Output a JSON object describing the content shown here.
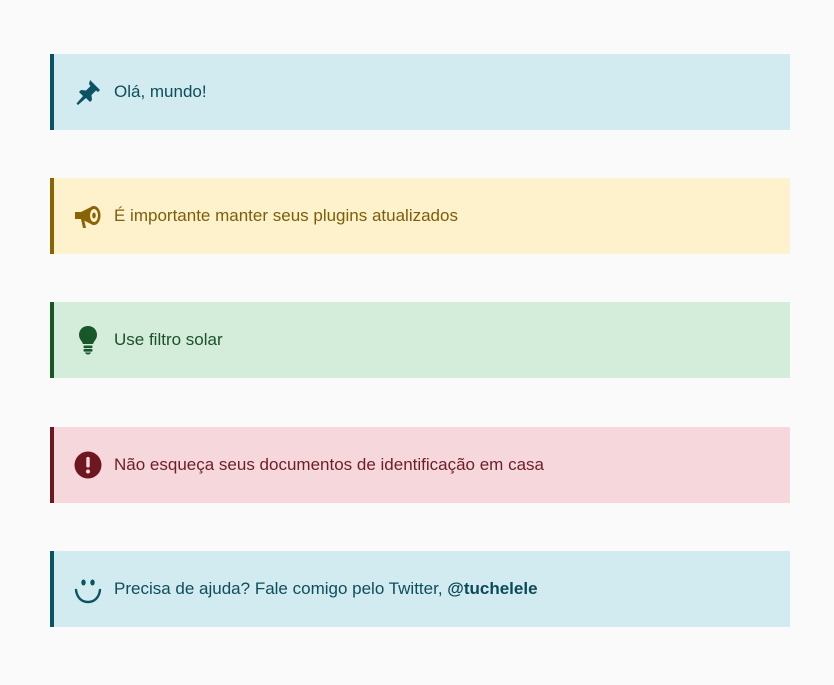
{
  "notices": [
    {
      "text": "Olá, mundo!",
      "icon": "pushpin-icon",
      "color": "#0b5363"
    },
    {
      "text": "É importante manter seus plugins atualizados",
      "icon": "megaphone-icon",
      "color": "#8a6304"
    },
    {
      "text": "Use filtro solar",
      "icon": "lightbulb-icon",
      "color": "#185727"
    },
    {
      "text": "Não esqueça seus documentos de identificação em casa",
      "icon": "exclamation-circle-icon",
      "color": "#6f1721"
    },
    {
      "text": "Precisa de ajuda? Fale comigo pelo Twitter, ",
      "link": "@tuchelele",
      "icon": "smile-icon",
      "color": "#0b5363"
    }
  ]
}
